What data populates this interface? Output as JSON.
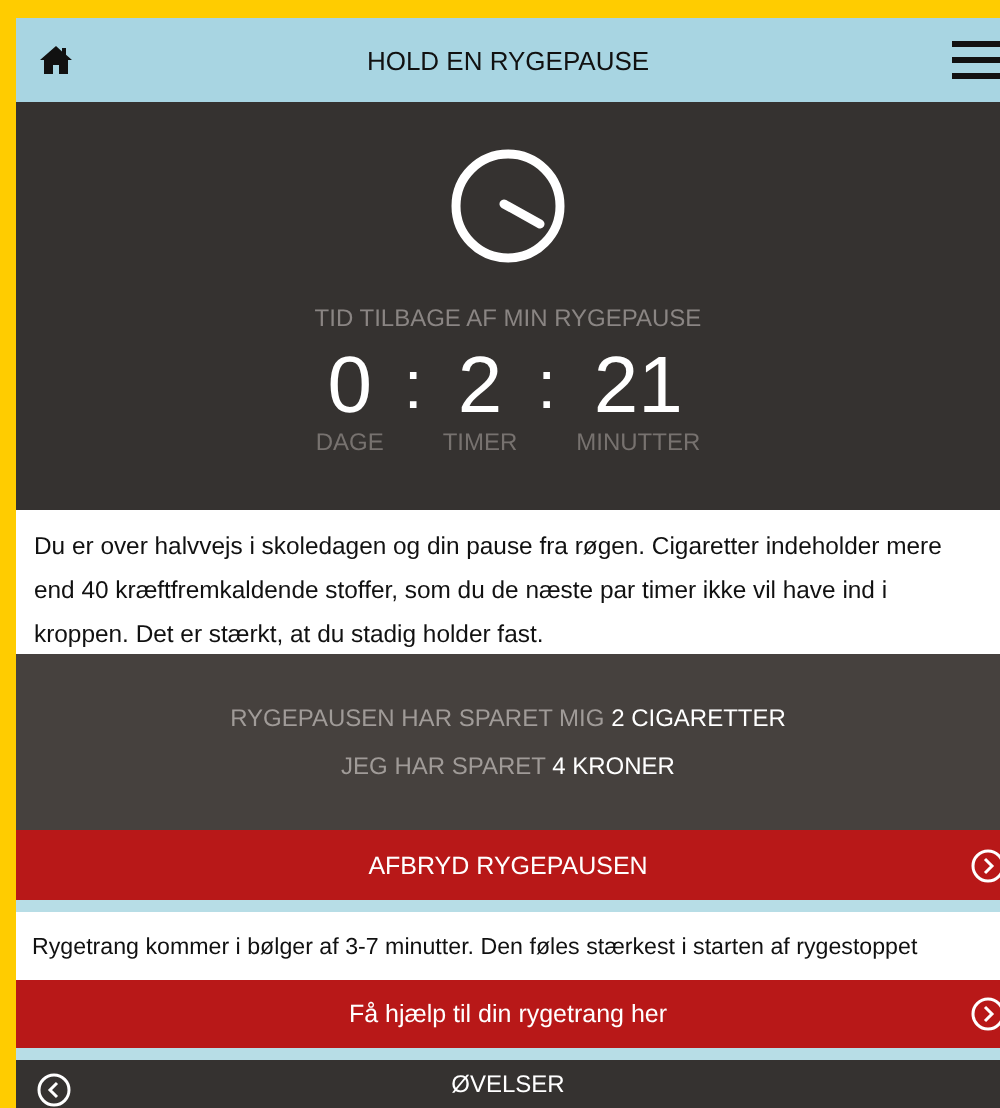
{
  "header": {
    "title": "HOLD EN RYGEPAUSE"
  },
  "timer": {
    "caption": "TID TILBAGE AF MIN RYGEPAUSE",
    "units": [
      {
        "value": "0",
        "label": "DAGE"
      },
      {
        "value": "2",
        "label": "TIMER"
      },
      {
        "value": "21",
        "label": "MINUTTER"
      }
    ],
    "separator": ":"
  },
  "message": "Du er over halvvejs i skoledagen og din pause fra røgen. Cigaretter indeholder mere end 40 kræftfremkaldende stoffer, som du de næste par timer ikke vil have ind i kroppen. Det er stærkt, at du stadig holder fast.",
  "savings": [
    {
      "label": "RYGEPAUSEN HAR SPARET MIG",
      "value": "2 CIGARETTER"
    },
    {
      "label": "JEG HAR SPARET",
      "value": "4 KRONER"
    }
  ],
  "stop_button": "AFBRYD RYGEPAUSEN",
  "craving_note": "Rygetrang kommer i bølger af 3-7 minutter. Den føles stærkest i starten af rygestoppet",
  "help_button": "Få hjælp til din rygetrang her",
  "footer": {
    "title": "ØVELSER"
  }
}
